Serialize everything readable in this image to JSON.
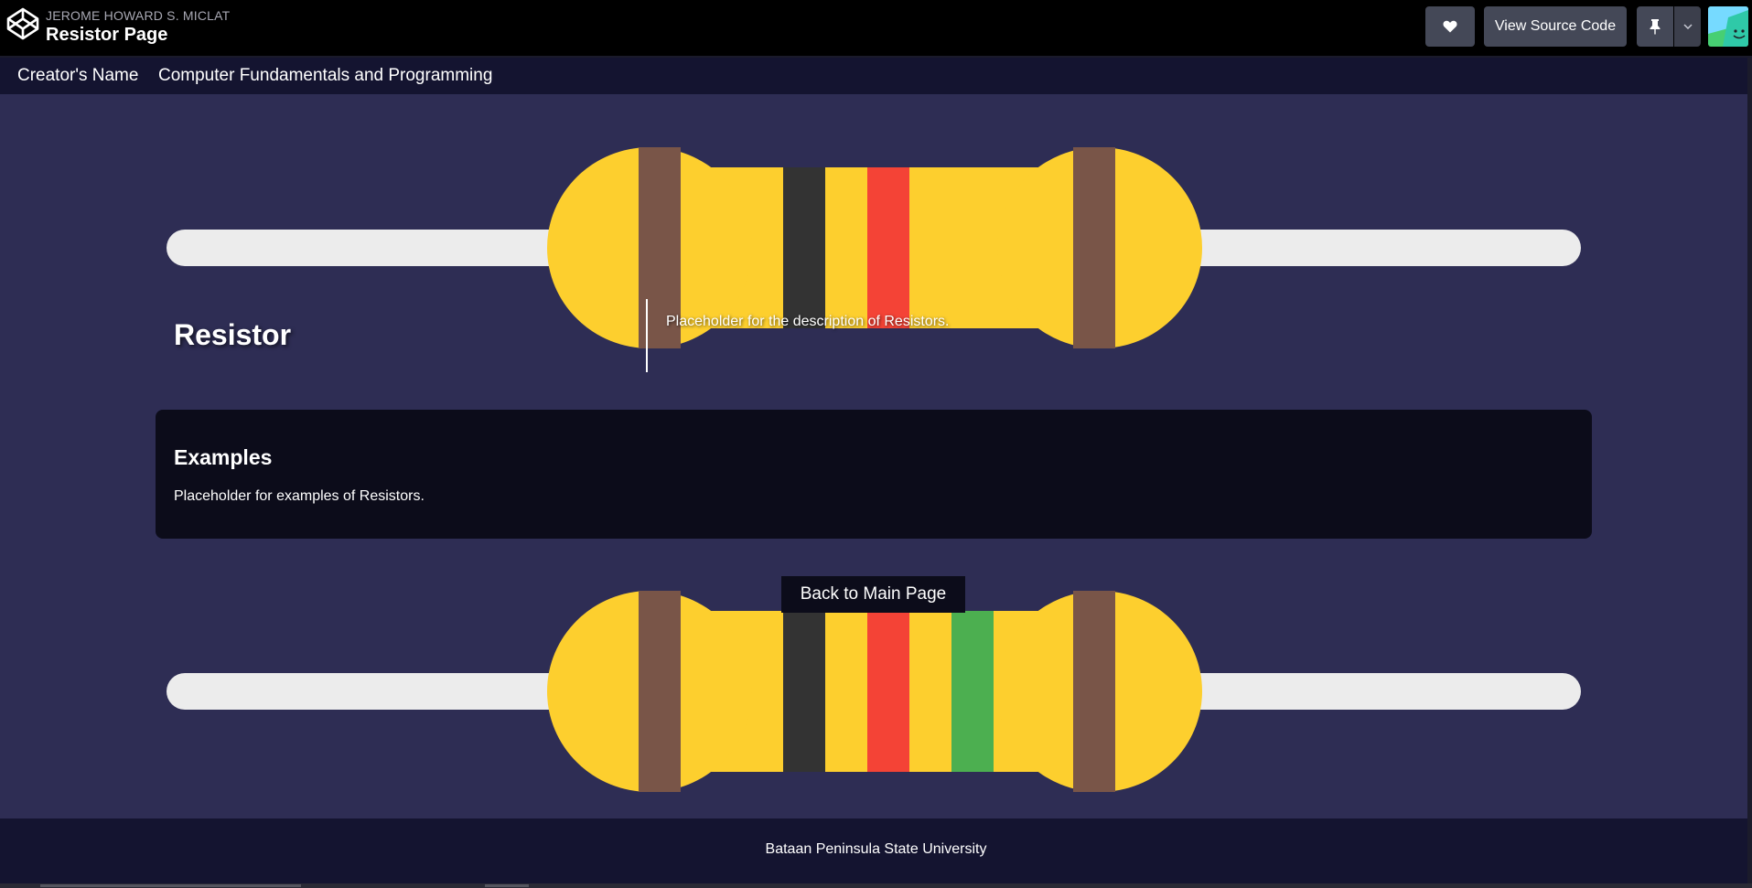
{
  "codepen": {
    "author": "JEROME HOWARD S. MICLAT",
    "title": "Resistor Page",
    "heart_icon": "heart-icon",
    "source_button": "View Source Code",
    "pin_icon": "pin-icon",
    "caret_icon": "chevron-down-icon"
  },
  "nav": {
    "items": [
      "Creator's Name",
      "Computer Fundamentals and Programming"
    ]
  },
  "colors": {
    "background": "#2e2d54",
    "resistor_body": "#fdcf2e",
    "lead": "#ececec",
    "brown": "#795548",
    "black": "#333333",
    "red": "#f44336",
    "green": "#4caf50"
  },
  "top_resistor": {
    "bands": [
      "brown",
      "black",
      "red",
      "brown"
    ]
  },
  "bottom_resistor": {
    "bands": [
      "brown",
      "black",
      "red",
      "green",
      "brown"
    ]
  },
  "hero": {
    "title": "Resistor",
    "description": "Placeholder for the description of Resistors."
  },
  "examples": {
    "title": "Examples",
    "text": "Placeholder for examples of Resistors."
  },
  "back_button": "Back to Main Page",
  "footer": "Bataan Peninsula State University"
}
